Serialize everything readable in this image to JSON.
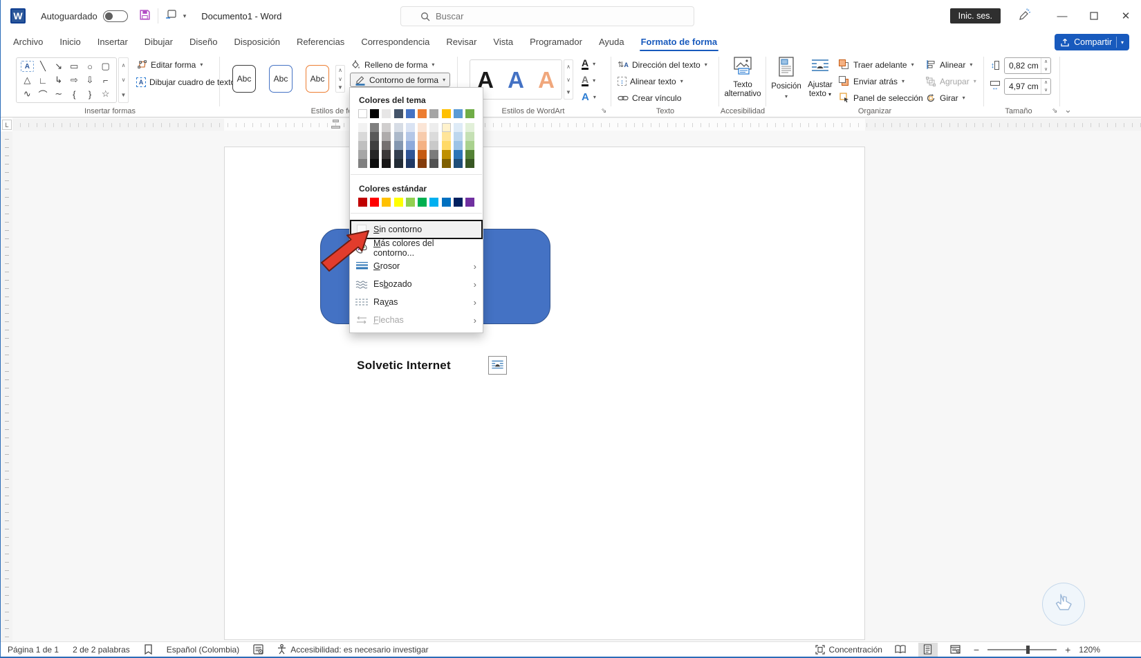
{
  "titlebar": {
    "autosave_label": "Autoguardado",
    "document_title": "Documento1 - Word",
    "search_placeholder": "Buscar",
    "signin_label": "Inic. ses."
  },
  "ribbon_tabs": {
    "items": [
      {
        "label": "Archivo",
        "active": false
      },
      {
        "label": "Inicio",
        "active": false
      },
      {
        "label": "Insertar",
        "active": false
      },
      {
        "label": "Dibujar",
        "active": false
      },
      {
        "label": "Diseño",
        "active": false
      },
      {
        "label": "Disposición",
        "active": false
      },
      {
        "label": "Referencias",
        "active": false
      },
      {
        "label": "Correspondencia",
        "active": false
      },
      {
        "label": "Revisar",
        "active": false
      },
      {
        "label": "Vista",
        "active": false
      },
      {
        "label": "Programador",
        "active": false
      },
      {
        "label": "Ayuda",
        "active": false
      },
      {
        "label": "Formato de forma",
        "active": true
      }
    ],
    "share_label": "Compartir"
  },
  "ribbon": {
    "insert_shapes": {
      "label": "Insertar formas",
      "edit_shape": "Editar forma",
      "draw_textbox": "Dibujar cuadro de texto",
      "gallery": [
        [
          "text-box",
          "line",
          "arrow",
          "rectangle",
          "oval",
          "rounded-rectangle"
        ],
        [
          "triangle",
          "elbow-connector",
          "elbow-arrow-connector",
          "right-arrow",
          "down-arrow",
          "corner-shape"
        ],
        [
          "scribble",
          "arc",
          "curve",
          "left-brace",
          "right-brace",
          "star"
        ]
      ]
    },
    "shape_styles": {
      "label": "Estilos de forma",
      "presets": [
        "Abc",
        "Abc",
        "Abc"
      ],
      "preset_colors": [
        "#3b3b3b",
        "#4472c4",
        "#ed7d31"
      ],
      "fill": "Relleno de forma",
      "outline": "Contorno de forma"
    },
    "wordart": {
      "label": "Estilos de WordArt",
      "letters": [
        "A",
        "A",
        "A"
      ],
      "letter_colors": [
        "#1a1a1a",
        "#4472c4",
        "#f0a77c"
      ]
    },
    "text_group": {
      "label": "Texto",
      "direction": "Dirección del texto",
      "align": "Alinear texto",
      "link": "Crear vínculo"
    },
    "accessibility": {
      "label": "Accesibilidad",
      "alt_text": "Texto alternativo"
    },
    "arrange": {
      "label": "Organizar",
      "position": "Posición",
      "wrap_line1": "Ajustar",
      "wrap_line2": "texto",
      "bring_forward": "Traer adelante",
      "send_backward": "Enviar atrás",
      "selection_pane": "Panel de selección",
      "align": "Alinear",
      "group": "Agrupar",
      "rotate": "Girar"
    },
    "size": {
      "label": "Tamaño",
      "height_value": "0,82 cm",
      "width_value": "4,97 cm"
    }
  },
  "outline_menu": {
    "theme_title": "Colores del tema",
    "standard_title": "Colores estándar",
    "theme_colors": [
      "#FFFFFF",
      "#000000",
      "#E7E6E6",
      "#44546A",
      "#4472C4",
      "#ED7D31",
      "#A5A5A5",
      "#FFC000",
      "#5B9BD5",
      "#70AD47"
    ],
    "theme_variants": [
      [
        "#F2F2F2",
        "#D9D9D9",
        "#BFBFBF",
        "#A6A6A6",
        "#808080"
      ],
      [
        "#7F7F7F",
        "#595959",
        "#404040",
        "#262626",
        "#0D0D0D"
      ],
      [
        "#D0CECE",
        "#AEABAB",
        "#757070",
        "#3B3838",
        "#171616"
      ],
      [
        "#D6DCE5",
        "#ACB9CA",
        "#8497B0",
        "#333F50",
        "#222B35"
      ],
      [
        "#DAE3F3",
        "#B4C7E7",
        "#8EAADB",
        "#2F5597",
        "#1F3864"
      ],
      [
        "#FBE5D6",
        "#F7CBAC",
        "#F4B183",
        "#C55A11",
        "#843C0C"
      ],
      [
        "#EDEDED",
        "#DBDBDB",
        "#C9C9C9",
        "#7B7B7B",
        "#525252"
      ],
      [
        "#FFF2CC",
        "#FFE599",
        "#FFD966",
        "#BF9000",
        "#7F6000"
      ],
      [
        "#DEEBF7",
        "#BDD7EE",
        "#9DC3E6",
        "#2E75B6",
        "#1F4E79"
      ],
      [
        "#E2F0D9",
        "#C5E0B4",
        "#A9D18E",
        "#548235",
        "#385723"
      ]
    ],
    "standard_colors": [
      "#C00000",
      "#FF0000",
      "#FFC000",
      "#FFFF00",
      "#92D050",
      "#00B050",
      "#00B0F0",
      "#0070C0",
      "#002060",
      "#7030A0"
    ],
    "items": [
      {
        "label": "Sin contorno",
        "accel": 0,
        "icon": "no-outline-swatch-icon",
        "selected": true,
        "disabled": false,
        "submenu": false
      },
      {
        "label": "Más colores del contorno...",
        "accel": 0,
        "icon": "palette-icon",
        "selected": false,
        "disabled": false,
        "submenu": false
      },
      {
        "label": "Grosor",
        "accel": 0,
        "icon": "line-weight-icon",
        "selected": false,
        "disabled": false,
        "submenu": true
      },
      {
        "label": "Esbozado",
        "accel": 2,
        "icon": "sketched-line-icon",
        "selected": false,
        "disabled": false,
        "submenu": true
      },
      {
        "label": "Rayas",
        "accel": 2,
        "icon": "dashed-line-icon",
        "selected": false,
        "disabled": false,
        "submenu": true
      },
      {
        "label": "Flechas",
        "accel": 0,
        "icon": "arrows-icon",
        "selected": false,
        "disabled": true,
        "submenu": true
      }
    ]
  },
  "document": {
    "caption": "Solvetic Internet",
    "shape_fill": "#4472C4",
    "shape_border": "#2F528F"
  },
  "statusbar": {
    "page": "Página 1 de 1",
    "words": "2 de 2 palabras",
    "language": "Español (Colombia)",
    "accessibility": "Accesibilidad: es necesario investigar",
    "focus": "Concentración",
    "zoom": "120%"
  }
}
